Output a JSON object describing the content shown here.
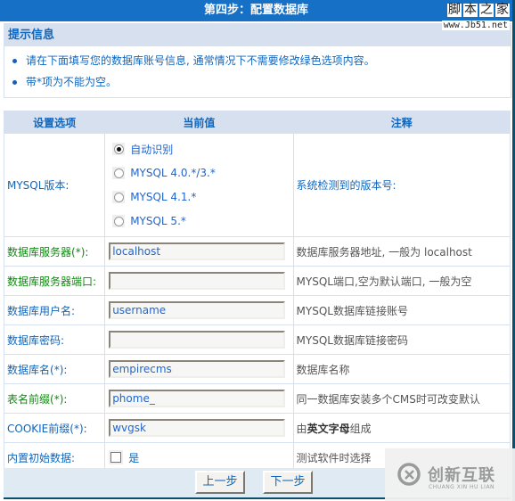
{
  "header": {
    "title": "第四步：配置数据库"
  },
  "watermark_top": {
    "chars": [
      "脚",
      "本",
      "之",
      "家"
    ],
    "url": "www.Jb51.net"
  },
  "tips": {
    "title": "提示信息",
    "items": [
      "请在下面填写您的数据库账号信息, 通常情况下不需要修改绿色选项内容。",
      "带*项为不能为空。"
    ]
  },
  "table": {
    "headers": [
      "设置选项",
      "当前值",
      "注释"
    ],
    "mysql_version": {
      "label": "MYSQL版本:",
      "options": [
        {
          "label": "自动识别",
          "checked": true
        },
        {
          "label": "MYSQL 4.0.*/3.*",
          "checked": false
        },
        {
          "label": "MYSQL 4.1.*",
          "checked": false
        },
        {
          "label": "MYSQL 5.*",
          "checked": false
        }
      ],
      "note": "系统检测到的版本号:"
    },
    "rows": [
      {
        "label": "数据库服务器",
        "required": "(*)",
        "suffix": ":",
        "value": "localhost",
        "note": "数据库服务器地址, 一般为  localhost"
      },
      {
        "label": "数据库服务器端口:",
        "value": "",
        "note": "MYSQL端口,空为默认端口, 一般为空"
      },
      {
        "label": "数据库用户名:",
        "value": "username",
        "note": "MYSQL数据库链接账号"
      },
      {
        "label": "数据库密码:",
        "value": "",
        "note": "MYSQL数据库链接密码"
      },
      {
        "label": "数据库名",
        "required": "(*)",
        "suffix": ":",
        "value": "empirecms",
        "note": "数据库名称"
      },
      {
        "label": "表名前缀",
        "required": "(*)",
        "suffix": ":",
        "value": "phome_",
        "note": "同一数据库安装多个CMS时可改变默认"
      },
      {
        "label": "COOKIE前缀",
        "required": "(*)",
        "suffix": ":",
        "value": "wvgsk",
        "note_pre": "由",
        "note_bold": "英文字母",
        "note_post": "组成"
      }
    ],
    "init_data": {
      "label": "内置初始数据:",
      "checkbox_label": "是",
      "checked": false,
      "note": "测试软件时选择"
    }
  },
  "buttons": {
    "prev": "上一步",
    "next": "下一步"
  },
  "watermark_bottom": {
    "cn": "创新互联",
    "en": "CHUANG XIN HU LIAN"
  },
  "colors": {
    "title_bar": "#1671c6",
    "header_bg": "#d6e0ef",
    "label_blue": "#1166bb",
    "label_green": "#118811",
    "input_text": "#2266cc",
    "button_bar": "#dfeaf3"
  }
}
